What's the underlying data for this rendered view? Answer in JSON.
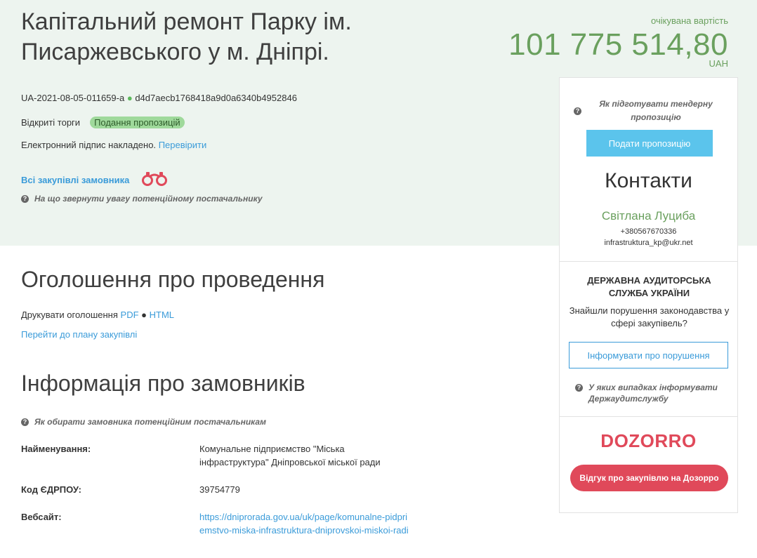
{
  "tender": {
    "title": "Капітальний ремонт Парку ім. Писаржевського у м. Дніпрі.",
    "id": "UA-2021-08-05-011659-a",
    "hash": "d4d7aecb1768418a9d0a6340b4952846",
    "procedure": "Відкриті торги",
    "status_badge": "Подання пропозицій",
    "signature_text": "Електронний підпис накладено.",
    "signature_link": "Перевірити",
    "all_purchases_link": "Всі закупівлі замовника",
    "supplier_hint": "На що звернути увагу потенційному постачальнику"
  },
  "cost": {
    "label": "очікувана вартість",
    "value": "101 775 514,80",
    "currency": "UAH"
  },
  "announcement": {
    "heading": "Оголошення про проведення",
    "print_label": "Друкувати оголошення",
    "pdf_link": "PDF",
    "html_link": "HTML",
    "plan_link": "Перейти до плану закупівлі"
  },
  "customers": {
    "heading": "Інформація про замовників",
    "hint": "Як обирати замовника потенційним постачальникам",
    "rows": [
      {
        "label": "Найменування:",
        "value": "Комунальне підприємство \"Міська інфраструктура\" Дніпровської міської ради"
      },
      {
        "label": "Код ЄДРПОУ:",
        "value": "39754779"
      },
      {
        "label": "Вебсайт:",
        "value": "https://dniprorada.gov.ua/uk/page/komunalne-pidpriemstvo-miska-infrastruktura-dniprovskoi-miskoi-radi"
      }
    ]
  },
  "sidebar": {
    "prepare_hint": "Як підготувати тендерну пропозицію",
    "propose_button": "Подати пропозицію",
    "contacts_title": "Контакти",
    "contact_name": "Світлана Луциба",
    "contact_phone": "+380567670336",
    "contact_email": "infrastruktura_kp@ukr.net",
    "audit_title": "ДЕРЖАВНА АУДИТОРСЬКА СЛУЖБА УКРАЇНИ",
    "audit_text": "Знайшли порушення законодавства у сфері закупівель?",
    "inform_button": "Інформувати про порушення",
    "audit_hint": "У яких випадках інформувати Держаудитслужбу",
    "dozorro_logo": "DOZORRO",
    "dozorro_button": "Відгук про закупівлю на Дозорро"
  },
  "colors": {
    "accent_green": "#6aa05e",
    "link_blue": "#3a9bd9",
    "dozorro_red": "#e0495a",
    "propose_blue": "#5bc4ec",
    "badge_green": "#9fd99b"
  }
}
